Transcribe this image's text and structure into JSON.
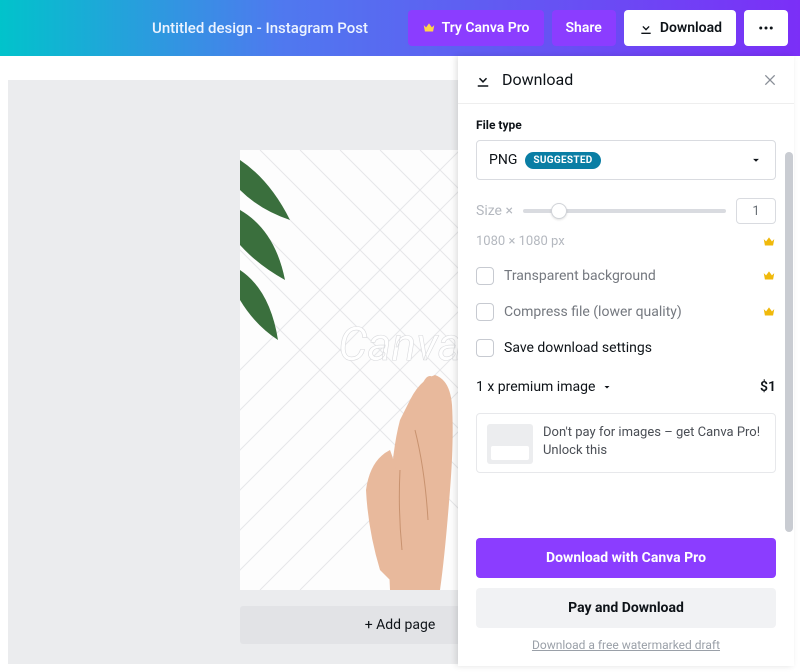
{
  "header": {
    "title": "Untitled design - Instagram Post",
    "try_pro": "Try Canva Pro",
    "share": "Share",
    "download": "Download"
  },
  "canvas": {
    "watermark": "Canva",
    "add_page": "+ Add page"
  },
  "panel": {
    "title": "Download",
    "file_type_label": "File type",
    "file_type_value": "PNG",
    "suggested_badge": "SUGGESTED",
    "size_label": "Size ×",
    "size_value": "1",
    "dimensions": "1080 × 1080 px",
    "opt_transparent": "Transparent background",
    "opt_compress": "Compress file (lower quality)",
    "opt_save_settings": "Save download settings",
    "premium_summary": "1 x premium image",
    "premium_price": "$1",
    "promo_text": "Don't pay for images – get Canva Pro! Unlock this",
    "btn_pro": "Download with Canva Pro",
    "btn_pay": "Pay and Download",
    "watermark_link": "Download a free watermarked draft"
  }
}
